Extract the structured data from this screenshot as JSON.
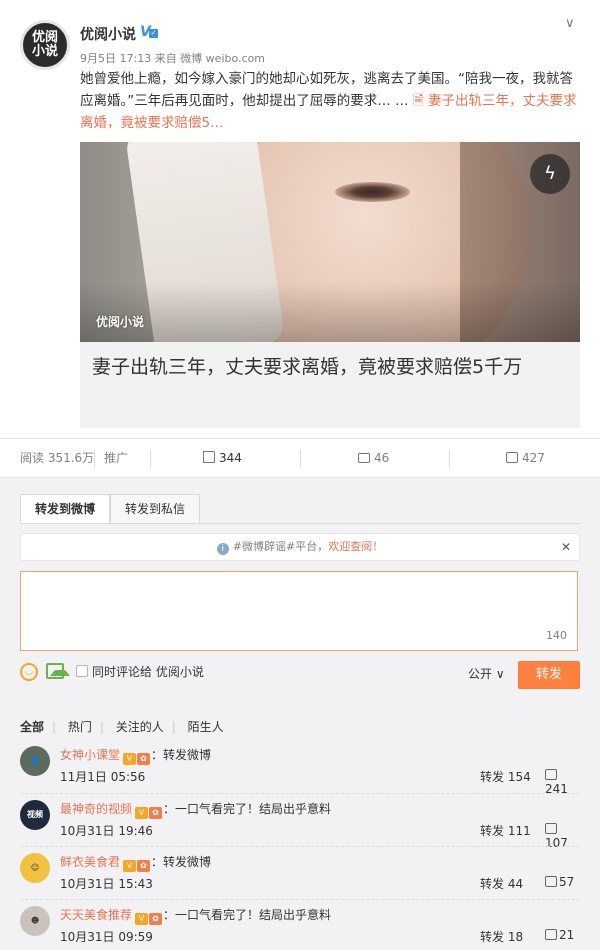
{
  "post": {
    "author": "优阅小说",
    "avatar_text": "优阅小说",
    "meta": "9月5日 17:13 来自 微博 weibo.com",
    "text_main": "她曾爱他上瘾，如今嫁入豪门的她却心如死灰，逃离去了美国。“陪我一夜，我就答应离婚。”三年后再见面时，他却提出了屈辱的要求… …",
    "text_link": "🗎 妻子出轨三年，丈夫要求离婚，竟被要求赔偿5…",
    "card_watermark": "优阅小说",
    "card_title": "妻子出轨三年，丈夫要求离婚，竟被要求赔偿5千万",
    "icons": {
      "verified": "verified-v-icon",
      "menu": "chevron-down-icon",
      "flash": "lightning-icon"
    }
  },
  "actions": {
    "reads": "阅读 351.6万",
    "promote": "推广",
    "forward_count": "344",
    "comment_count": "46",
    "like_count": "427"
  },
  "forward_panel": {
    "tab_weibo": "转发到微博",
    "tab_private": "转发到私信",
    "notice_prefix": "#微博辟谣#平台，",
    "notice_highlight": "欢迎查阅！",
    "char_count": "140",
    "also_comment": "同时评论给 优阅小说",
    "visibility": "公开",
    "send": "转发",
    "colors": {
      "accent": "#ff8140",
      "link": "#eb7350"
    }
  },
  "filters": [
    "全部",
    "热门",
    "关注的人",
    "陌生人"
  ],
  "reposts": [
    {
      "name": "女神小课堂",
      "message": "：转发微博",
      "time": "11月1日 05:56",
      "rt_label": "转发",
      "rt_count": "154",
      "likes": "241",
      "avatar_color": "#5c6b5e"
    },
    {
      "name": "最神奇的视频",
      "message": "：一口气看完了！结局出乎意料",
      "time": "10月31日 19:46",
      "rt_label": "转发",
      "rt_count": "111",
      "likes": "107",
      "avatar_color": "#1f2a3d"
    },
    {
      "name": "鲜衣美食君",
      "message": "：转发微博",
      "time": "10月31日 15:43",
      "rt_label": "转发",
      "rt_count": "44",
      "likes": "57",
      "avatar_color": "#f0c23d"
    },
    {
      "name": "天天美食推荐",
      "message": "：一口气看完了！结局出乎意料",
      "time": "10月31日 09:59",
      "rt_label": "转发",
      "rt_count": "18",
      "likes": "21",
      "avatar_color": "#c9c3bb"
    }
  ]
}
